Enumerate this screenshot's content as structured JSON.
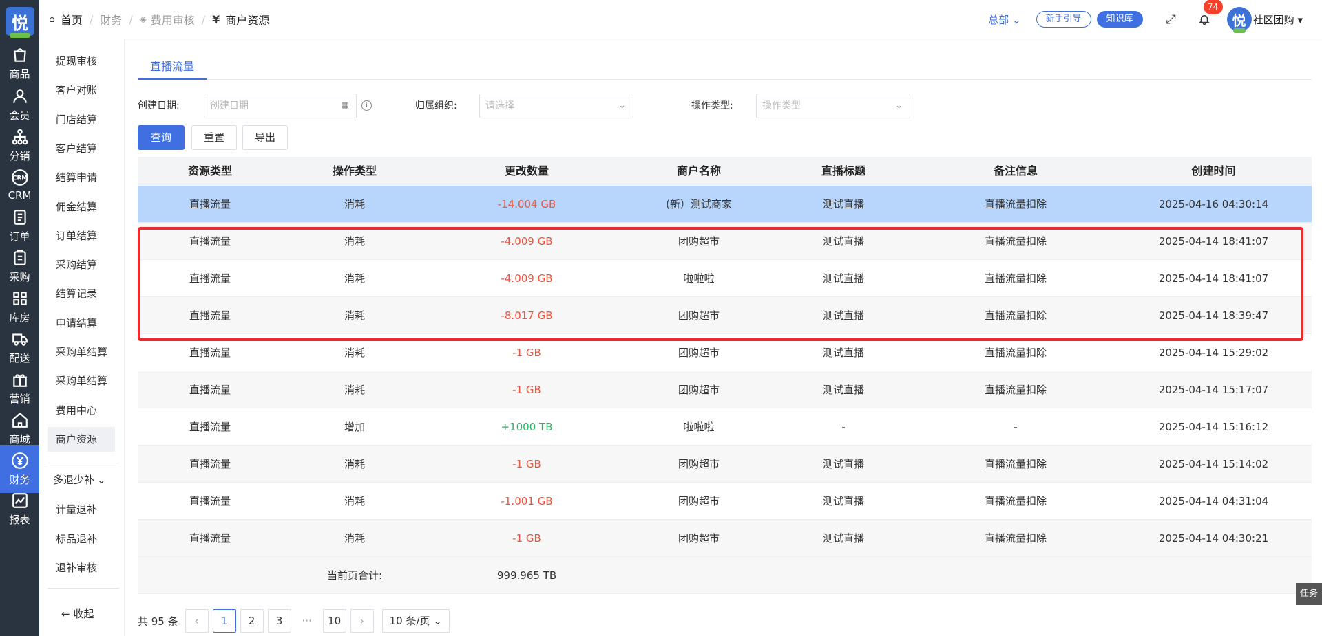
{
  "rail": {
    "logo_text": "悦",
    "items": [
      {
        "label": "商品",
        "icon": "bag-icon"
      },
      {
        "label": "会员",
        "icon": "user-icon"
      },
      {
        "label": "分销",
        "icon": "tree-icon"
      },
      {
        "label": "CRM",
        "icon": "crm-icon"
      },
      {
        "label": "订单",
        "icon": "doc-icon"
      },
      {
        "label": "采购",
        "icon": "clipboard-icon"
      },
      {
        "label": "库房",
        "icon": "grid-icon"
      },
      {
        "label": "配送",
        "icon": "truck-icon"
      },
      {
        "label": "营销",
        "icon": "gift-icon"
      },
      {
        "label": "商城",
        "icon": "house-icon"
      },
      {
        "label": "财务",
        "icon": "yen-icon"
      },
      {
        "label": "报表",
        "icon": "chart-icon"
      }
    ]
  },
  "submenu": {
    "items": [
      "提现审核",
      "客户对账",
      "门店结算",
      "客户结算",
      "结算申请",
      "佣金结算",
      "订单结算",
      "采购结算",
      "结算记录",
      "申请结算",
      "采购单结算",
      "采购单结算",
      "费用中心",
      "商户资源"
    ],
    "group_label": "多退少补",
    "group_items": [
      "计量退补",
      "标品退补",
      "退补审核"
    ],
    "collapse_label": "收起"
  },
  "header": {
    "breadcrumb": {
      "home": "首页",
      "b1": "财务",
      "b2": "费用审核",
      "current": "商户资源"
    },
    "org": "总部",
    "guide": "新手引导",
    "kb": "知识库",
    "notif_count": "74",
    "avatar_text": "悦",
    "user": "社区团购"
  },
  "tab": {
    "label": "直播流量"
  },
  "filters": {
    "date_label": "创建日期:",
    "date_placeholder": "创建日期",
    "org_label": "归属组织:",
    "org_placeholder": "请选择",
    "op_label": "操作类型:",
    "op_placeholder": "操作类型"
  },
  "buttons": {
    "query": "查询",
    "reset": "重置",
    "export": "导出"
  },
  "table": {
    "headers": [
      "资源类型",
      "操作类型",
      "更改数量",
      "商户名称",
      "直播标题",
      "备注信息",
      "创建时间"
    ],
    "rows": [
      [
        "直播流量",
        "消耗",
        "-14.004 GB",
        "(新）测试商家",
        "测试直播",
        "直播流量扣除",
        "2025-04-16 04:30:14"
      ],
      [
        "直播流量",
        "消耗",
        "-4.009 GB",
        "团购超市",
        "测试直播",
        "直播流量扣除",
        "2025-04-14 18:41:07"
      ],
      [
        "直播流量",
        "消耗",
        "-4.009 GB",
        "啦啦啦",
        "测试直播",
        "直播流量扣除",
        "2025-04-14 18:41:07"
      ],
      [
        "直播流量",
        "消耗",
        "-8.017 GB",
        "团购超市",
        "测试直播",
        "直播流量扣除",
        "2025-04-14 18:39:47"
      ],
      [
        "直播流量",
        "消耗",
        "-1 GB",
        "团购超市",
        "测试直播",
        "直播流量扣除",
        "2025-04-14 15:29:02"
      ],
      [
        "直播流量",
        "消耗",
        "-1 GB",
        "团购超市",
        "测试直播",
        "直播流量扣除",
        "2025-04-14 15:17:07"
      ],
      [
        "直播流量",
        "增加",
        "+1000 TB",
        "啦啦啦",
        "-",
        "-",
        "2025-04-14 15:16:12"
      ],
      [
        "直播流量",
        "消耗",
        "-1 GB",
        "团购超市",
        "测试直播",
        "直播流量扣除",
        "2025-04-14 15:14:02"
      ],
      [
        "直播流量",
        "消耗",
        "-1.001 GB",
        "团购超市",
        "测试直播",
        "直播流量扣除",
        "2025-04-14 04:31:04"
      ],
      [
        "直播流量",
        "消耗",
        "-1 GB",
        "团购超市",
        "测试直播",
        "直播流量扣除",
        "2025-04-14 04:30:21"
      ]
    ],
    "footer_label": "当前页合计:",
    "footer_total": "999.965 TB"
  },
  "pager": {
    "total": "共 95 条",
    "pages": [
      "1",
      "2",
      "3",
      "10"
    ],
    "ellipsis": "···",
    "size": "10 条/页"
  },
  "task_tab": "任务",
  "colors": {
    "accent": "#3f6fe0",
    "negative": "#f0533c",
    "positive": "#2bb361",
    "highlight": "#ee2b2b",
    "selected_row": "#b8d6fb"
  }
}
